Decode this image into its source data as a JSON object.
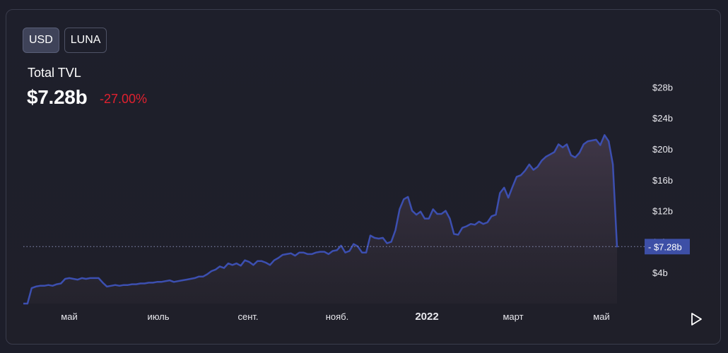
{
  "currency_toggle": {
    "usd_label": "USD",
    "luna_label": "LUNA",
    "selected": "USD"
  },
  "summary": {
    "title": "Total TVL",
    "value": "$7.28b",
    "change": "-27.00%"
  },
  "colors": {
    "line": "#3c4fb0",
    "change_negative": "#e0212f",
    "current_badge": "#3d4fa6"
  },
  "icons": {
    "play": "play-icon"
  },
  "chart_data": {
    "type": "area",
    "x_tick_labels": [
      "май",
      "июль",
      "сент.",
      "нояб.",
      "2022",
      "март",
      "май"
    ],
    "y_tick_labels": [
      "$4b",
      "$8b",
      "$12b",
      "$16b",
      "$20b",
      "$24b",
      "$28b"
    ],
    "y_ticks": [
      4,
      8,
      12,
      16,
      20,
      24,
      28
    ],
    "ylim": [
      0,
      30
    ],
    "y_unit": "billion USD",
    "current_value": 7.28,
    "current_label": "$7.28b",
    "grid": false,
    "series": [
      {
        "values": [
          0,
          0,
          2,
          2.2,
          2.3,
          2.3,
          2.4,
          2.3,
          2.5,
          2.6,
          3.2,
          3.3,
          3.2,
          3.1,
          3.3,
          3.2,
          3.3,
          3.3,
          3.3,
          2.7,
          2.2,
          2.3,
          2.4,
          2.3,
          2.4,
          2.4,
          2.5,
          2.5,
          2.6,
          2.6,
          2.7,
          2.7,
          2.8,
          2.8,
          2.9,
          3.0,
          2.8,
          2.9,
          3.0,
          3.1,
          3.2,
          3.3,
          3.5,
          3.5,
          3.8,
          4.2,
          4.4,
          4.8,
          4.6,
          5.2,
          5.0,
          5.2,
          4.9,
          5.6,
          5.4,
          5.0,
          5.5,
          5.5,
          5.3,
          5.0,
          5.6,
          5.9,
          6.3,
          6.4,
          6.5,
          6.2,
          6.6,
          6.6,
          6.4,
          6.4,
          6.6,
          6.7,
          6.7,
          6.4,
          6.8,
          6.9,
          7.5,
          6.6,
          6.8,
          7.7,
          7.4,
          6.6,
          6.6,
          8.8,
          8.5,
          8.4,
          8.5,
          7.8,
          8.0,
          9.5,
          12.2,
          13.5,
          13.8,
          12.0,
          11.5,
          11.9,
          11.0,
          11.0,
          12.2,
          11.6,
          11.6,
          12.0,
          11.0,
          9.0,
          8.9,
          9.8,
          10.0,
          10.3,
          10.2,
          10.6,
          10.3,
          10.5,
          11.3,
          11.5,
          14.3,
          15.0,
          13.7,
          15.1,
          16.4,
          16.6,
          17.2,
          18.0,
          17.3,
          17.7,
          18.5,
          19.0,
          19.3,
          19.6,
          20.6,
          20.2,
          20.6,
          19.2,
          18.9,
          19.5,
          20.6,
          21.0,
          21.1,
          21.2,
          20.5,
          21.8,
          21.0,
          18.0,
          7.28
        ]
      }
    ]
  }
}
